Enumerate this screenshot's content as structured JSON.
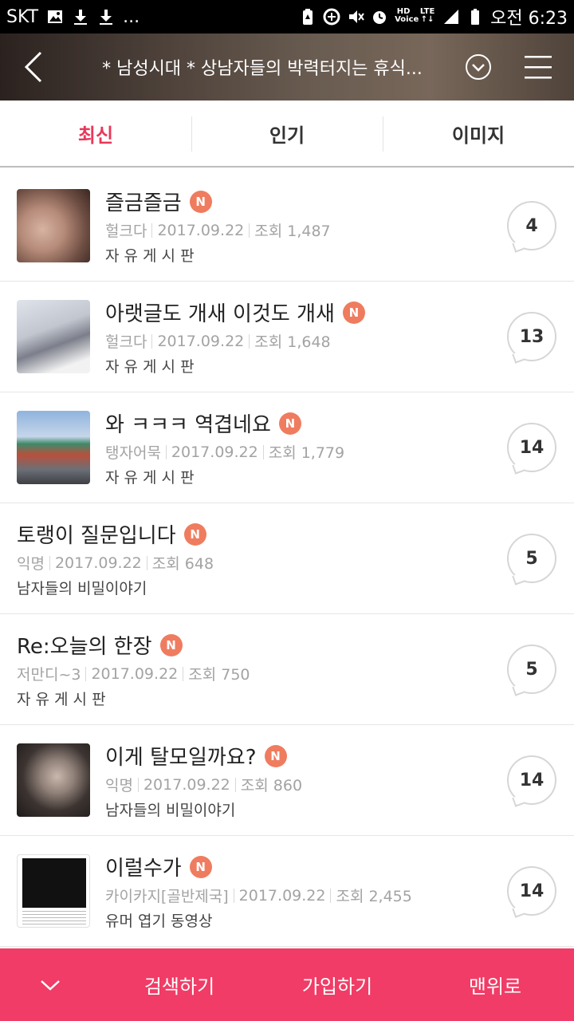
{
  "status": {
    "carrier": "SKT",
    "left_icons": [
      "image-icon",
      "download-icon",
      "download-icon"
    ],
    "more": "...",
    "right_icons": [
      "battery-saver-icon",
      "data-saver-icon",
      "mute-icon",
      "alarm-icon",
      "hd-voice-icon",
      "lte-icon",
      "signal-icon",
      "battery-icon"
    ],
    "time": "오전 6:23"
  },
  "header": {
    "title": "* 남성시대 * 상남자들의 박력터지는 휴식..."
  },
  "tabs": [
    {
      "label": "최신",
      "active": true
    },
    {
      "label": "인기",
      "active": false
    },
    {
      "label": "이미지",
      "active": false
    }
  ],
  "posts": [
    {
      "title": "즐금즐금",
      "badge": "N",
      "author": "헐크다",
      "date": "2017.09.22",
      "views": "조회 1,487",
      "board": "자 유 게 시 판",
      "comments": "4",
      "thumb": true
    },
    {
      "title": "아랫글도 개새 이것도 개새",
      "badge": "N",
      "author": "헐크다",
      "date": "2017.09.22",
      "views": "조회 1,648",
      "board": "자 유 게 시 판",
      "comments": "13",
      "thumb": true
    },
    {
      "title": "와 ㅋㅋㅋ 역겹네요",
      "badge": "N",
      "author": "탱자어묵",
      "date": "2017.09.22",
      "views": "조회 1,779",
      "board": "자 유 게 시 판",
      "comments": "14",
      "thumb": true
    },
    {
      "title": "토랭이 질문입니다",
      "badge": "N",
      "author": "익명",
      "date": "2017.09.22",
      "views": "조회 648",
      "board": "남자들의 비밀이야기",
      "comments": "5",
      "thumb": false
    },
    {
      "title": "Re:오늘의 한장",
      "badge": "N",
      "author": "저만디~3",
      "date": "2017.09.22",
      "views": "조회 750",
      "board": "자 유 게 시 판",
      "comments": "5",
      "thumb": false
    },
    {
      "title": "이게 탈모일까요?",
      "badge": "N",
      "author": "익명",
      "date": "2017.09.22",
      "views": "조회 860",
      "board": "남자들의 비밀이야기",
      "comments": "14",
      "thumb": true
    },
    {
      "title": "이럴수가",
      "badge": "N",
      "author": "카이카지[골반제국]",
      "date": "2017.09.22",
      "views": "조회 2,455",
      "board": "유머 엽기 동영상",
      "comments": "14",
      "thumb": true
    }
  ],
  "bottom": {
    "search": "검색하기",
    "join": "가입하기",
    "top": "맨위로"
  },
  "colors": {
    "accent": "#e8385b",
    "bottom_bar": "#f03c66",
    "new_badge": "#ef7c5f"
  }
}
